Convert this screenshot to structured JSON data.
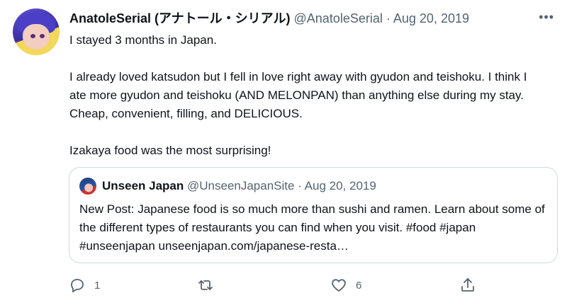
{
  "tweet": {
    "display_name": "AnatoleSerial (アナトール・シリアル)",
    "handle": "@AnatoleSerial",
    "separator": "·",
    "date": "Aug 20, 2019",
    "more": "•••",
    "paragraphs": [
      "I stayed 3 months in Japan.",
      "I already loved katsudon but I fell in love right away with gyudon and teishoku. I think I ate more gyudon and teishoku (AND MELONPAN) than anything else during my stay. Cheap, convenient, filling, and DELICIOUS.",
      "Izakaya food was the most surprising!"
    ]
  },
  "quote": {
    "display_name": "Unseen Japan",
    "handle": "@UnseenJapanSite",
    "separator": "·",
    "date": "Aug 20, 2019",
    "text": "New Post: Japanese food is so much more than sushi and ramen. Learn about some of the different types of restaurants you can find when you visit. #food #japan #unseenjapan  unseenjapan.com/japanese-resta…"
  },
  "actions": {
    "reply_count": "1",
    "retweet_count": "",
    "like_count": "6",
    "share_count": ""
  },
  "icons": {
    "more": "more-icon",
    "reply": "reply-icon",
    "retweet": "retweet-icon",
    "like": "heart-icon",
    "share": "share-icon"
  },
  "colors": {
    "text": "#0f1419",
    "muted": "#536471",
    "border": "#cfd9de"
  }
}
